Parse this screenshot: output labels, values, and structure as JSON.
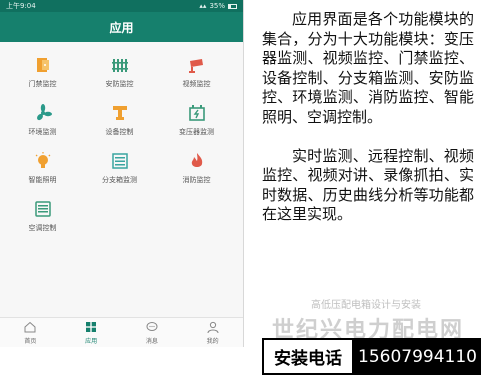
{
  "status_bar": {
    "time": "上午9:04",
    "battery": "35%"
  },
  "app": {
    "title": "应用"
  },
  "modules": [
    {
      "label": "门禁监控",
      "icon": "door-access-icon",
      "color": "#f0a030"
    },
    {
      "label": "安防监控",
      "icon": "fence-icon",
      "color": "#3a9a7a"
    },
    {
      "label": "视频监控",
      "icon": "camera-icon",
      "color": "#e05a4a"
    },
    {
      "label": "环境监测",
      "icon": "fan-icon",
      "color": "#2b9a8a"
    },
    {
      "label": "设备控制",
      "icon": "device-icon",
      "color": "#f0a030"
    },
    {
      "label": "变压器监测",
      "icon": "transformer-icon",
      "color": "#3a9a7a"
    },
    {
      "label": "智能照明",
      "icon": "bulb-icon",
      "color": "#f0a030"
    },
    {
      "label": "分支箱监测",
      "icon": "branch-box-icon",
      "color": "#3aa5a0"
    },
    {
      "label": "消防监控",
      "icon": "fire-icon",
      "color": "#e05a4a"
    },
    {
      "label": "空调控制",
      "icon": "aircon-icon",
      "color": "#3a9a7a"
    }
  ],
  "tabs": [
    {
      "label": "首页",
      "icon": "home-icon"
    },
    {
      "label": "应用",
      "icon": "apps-icon",
      "active": true
    },
    {
      "label": "消息",
      "icon": "message-icon"
    },
    {
      "label": "我的",
      "icon": "user-icon"
    }
  ],
  "description": {
    "paragraph1": "应用界面是各个功能模块的集合，分为十大功能模块：变压器监测、视频监控、门禁监控、设备控制、分支箱监测、安防监控、环境监测、消防监控、智能照明、空调控制。",
    "paragraph2": "实时监测、远程控制、视频监控、视频对讲、录像抓拍、实时数据、历史曲线分析等功能都在这里实现。"
  },
  "watermark": {
    "small": "高低压配电箱设计与安装",
    "big": "世纪兴电力配电网"
  },
  "contact": {
    "label": "安装电话",
    "number": "15607994110"
  },
  "colors": {
    "primary": "#16806d",
    "status_bar": "#10705f"
  }
}
